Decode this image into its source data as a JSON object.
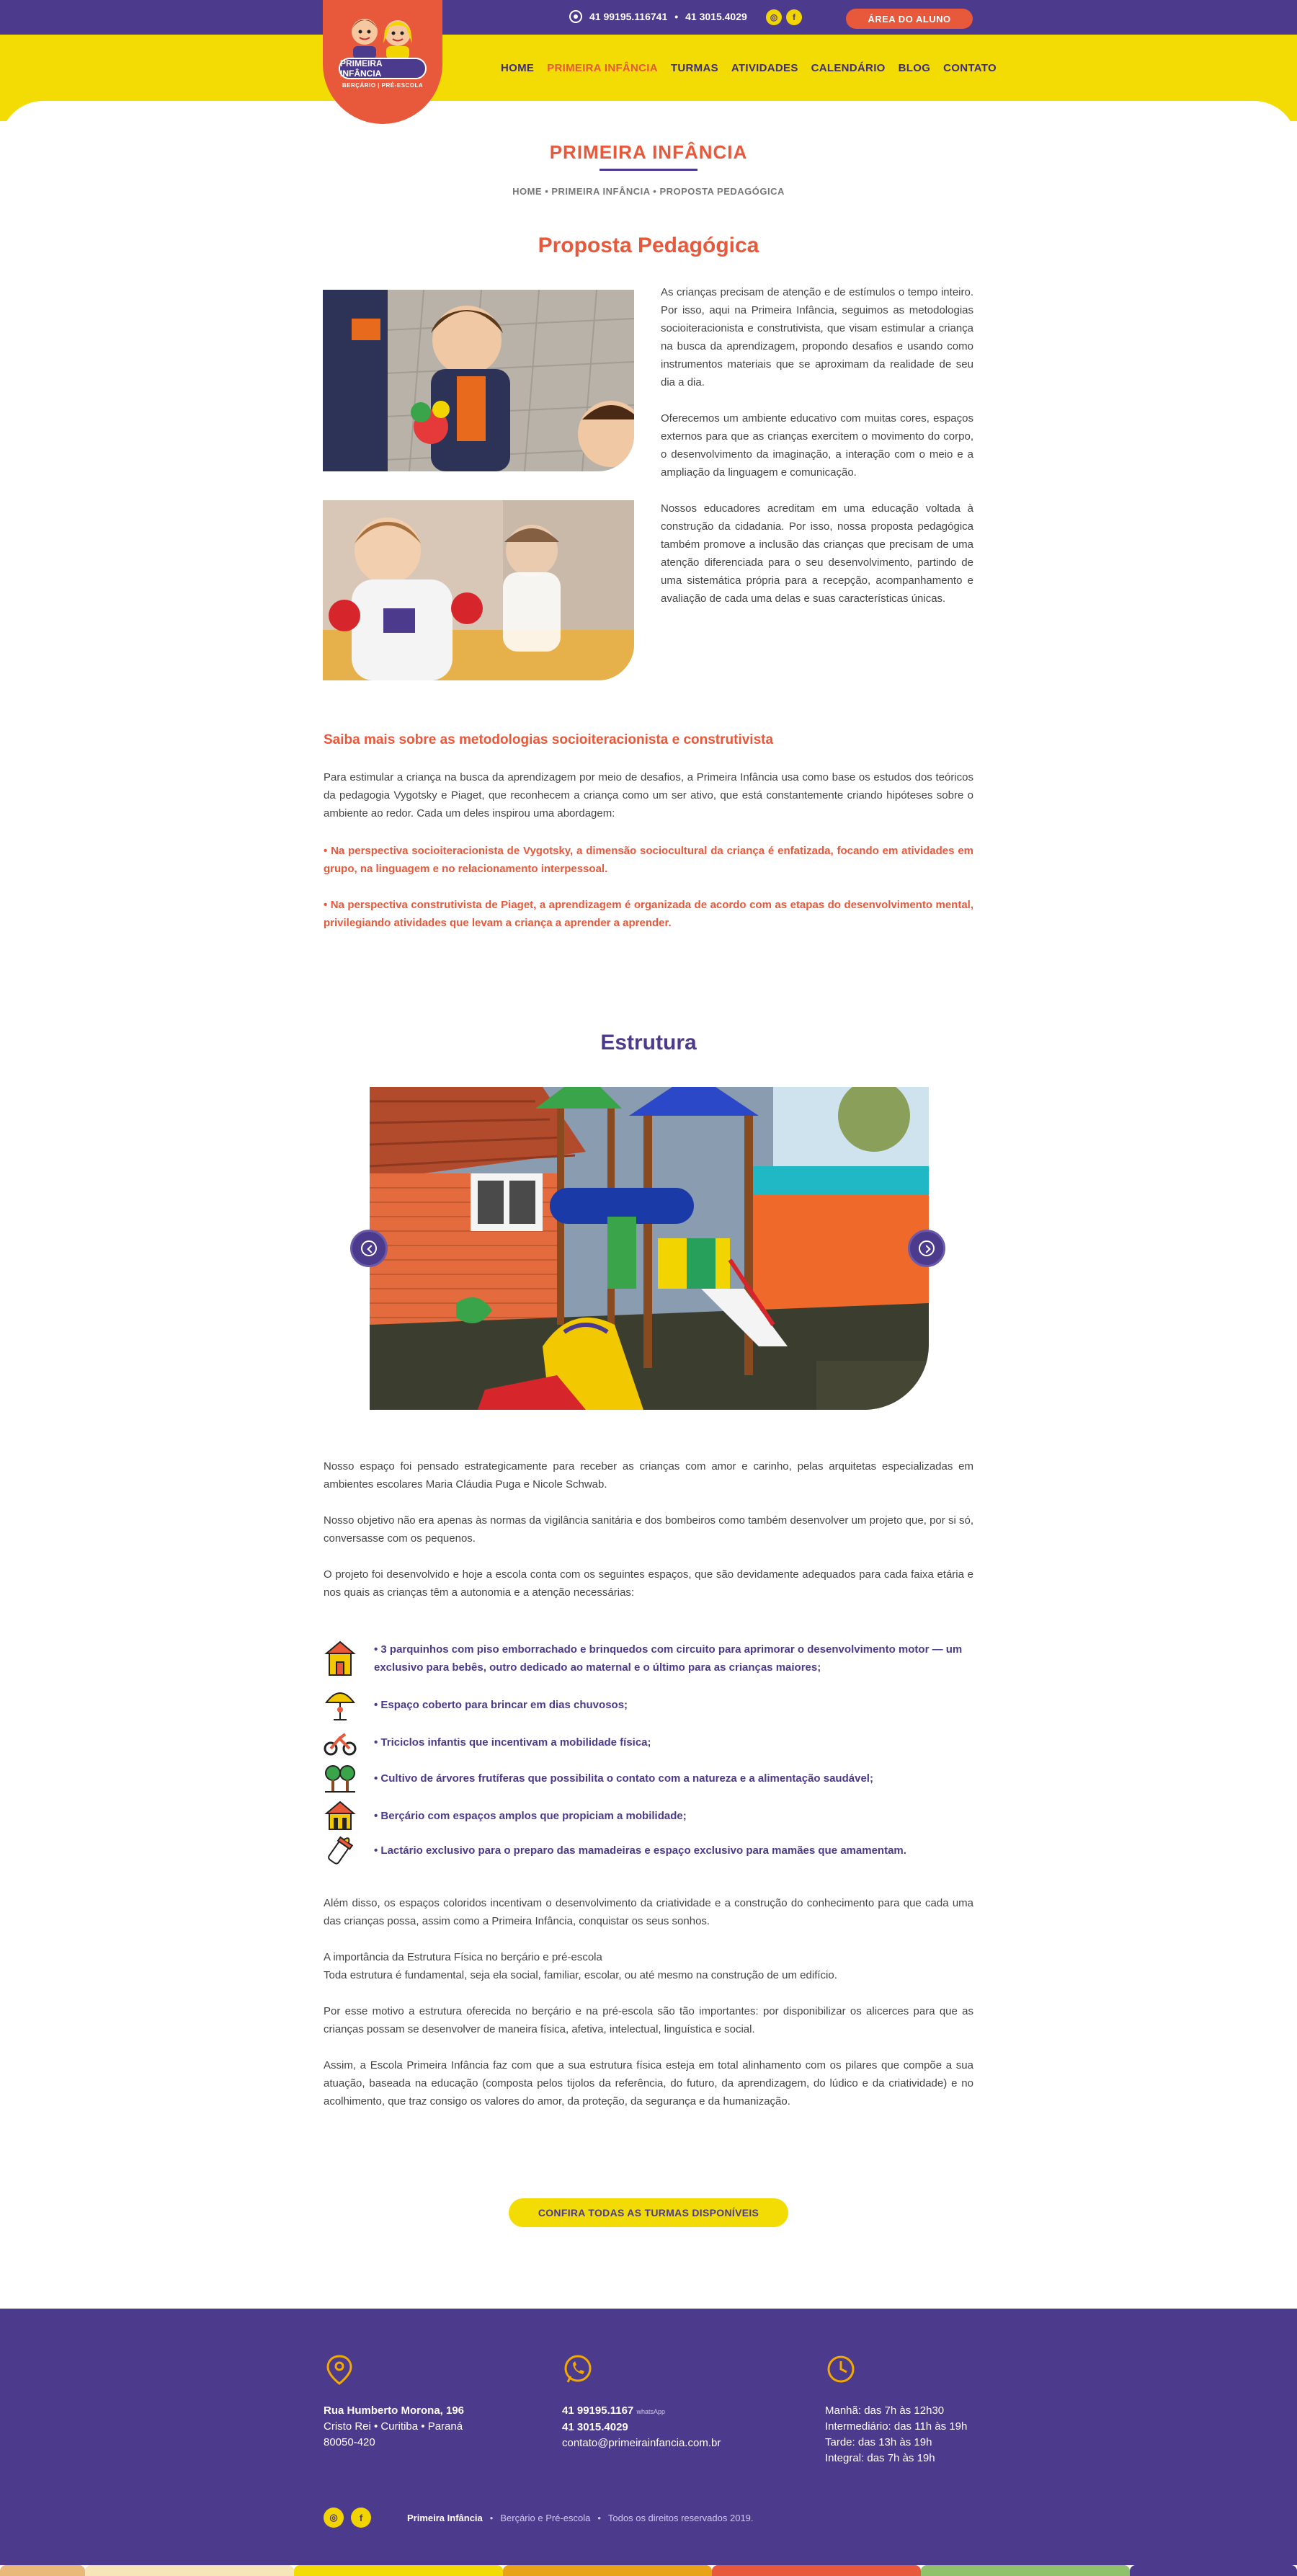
{
  "topbar": {
    "phone_whatsapp": "41 99195.1167 41",
    "phone_1": "41 99195.1167 41",
    "separator": "•",
    "phone_2": "41 3015.4029",
    "social": [
      "◎",
      "f"
    ],
    "area_button": "ÁREA DO ALUNO"
  },
  "logo": {
    "name": "PRIMEIRA INFÂNCIA",
    "subtitle": "BERÇÁRIO  |  PRÉ-ESCOLA"
  },
  "nav": {
    "items": [
      {
        "label": "HOME",
        "active": false
      },
      {
        "label": "PRIMEIRA INFÂNCIA",
        "active": true
      },
      {
        "label": "TURMAS",
        "active": false
      },
      {
        "label": "ATIVIDADES",
        "active": false
      },
      {
        "label": "CALENDÁRIO",
        "active": false
      },
      {
        "label": "BLOG",
        "active": false
      },
      {
        "label": "CONTATO",
        "active": false
      }
    ]
  },
  "page": {
    "title": "PRIMEIRA INFÂNCIA",
    "breadcrumb": "HOME • PRIMEIRA INFÂNCIA • PROPOSTA PEDAGÓGICA"
  },
  "proposta": {
    "title": "Proposta Pedagógica",
    "paragraphs": [
      "As crianças precisam de atenção e de estímulos o tempo inteiro. Por isso, aqui na Primeira Infância, seguimos as metodologias socioiteracionista e construtivista, que visam estimular a criança na busca da aprendizagem, propondo desafios e usando como instrumentos materiais que se aproximam da realidade de seu dia a dia.",
      "Oferecemos um ambiente educativo com muitas cores, espaços externos para que as crianças exercitem o movimento do corpo, o desenvolvimento da imaginação, a interação com o meio e a ampliação da linguagem e comunicação.",
      "Nossos educadores acreditam em uma educação voltada à construção da cidadania. Por isso, nossa proposta pedagógica também promove a inclusão das crianças que precisam de uma atenção diferenciada para o seu desenvolvimento, partindo de uma sistemática própria para a recepção, acompanhamento e avaliação de cada uma delas e suas características únicas."
    ]
  },
  "metodologias": {
    "title": "Saiba mais sobre as metodologias socioiteracionista e construtivista",
    "intro": "Para estimular a criança na busca da aprendizagem por meio de desafios, a Primeira Infância usa como base os estudos dos teóricos da pedagogia Vygotsky e Piaget, que reconhecem a criança como um ser ativo, que está constantemente criando hipóteses sobre o ambiente ao redor. Cada um deles inspirou uma abordagem:",
    "bullets": [
      "•   Na perspectiva socioiteracionista de Vygotsky, a dimensão sociocultural da criança é enfatizada, focando em atividades em grupo, na linguagem e no relacionamento interpessoal.",
      "•   Na perspectiva construtivista de Piaget, a aprendizagem é organizada de acordo com as etapas do desenvolvimento mental, privilegiando atividades que levam a criança a aprender a aprender."
    ]
  },
  "estrutura": {
    "title": "Estrutura",
    "paragraphs": [
      "Nosso espaço foi pensado estrategicamente para receber as crianças com amor e carinho, pelas arquitetas especializadas em ambientes escolares Maria Cláudia Puga e Nicole Schwab.",
      "Nosso objetivo não era apenas às normas da vigilância sanitária e dos bombeiros como também desenvolver um projeto que, por si só, conversasse com os pequenos.",
      "O projeto foi desenvolvido e hoje a escola conta com os seguintes espaços, que são devidamente adequados para cada faixa etária e nos quais as crianças têm a autonomia e a atenção necessárias:"
    ],
    "features": [
      {
        "icon": "playground-icon",
        "text": "•  3 parquinhos com piso emborrachado e brinquedos com  circuito para aprimorar o desenvolvimento motor — um exclusivo para bebês, outro dedicado ao maternal e o último para as crianças maiores;"
      },
      {
        "icon": "umbrella-icon",
        "text": "•  Espaço coberto para brincar em dias chuvosos;"
      },
      {
        "icon": "tricycle-icon",
        "text": "•  Triciclos infantis que incentivam a mobilidade física;"
      },
      {
        "icon": "trees-icon",
        "text": "•  Cultivo de árvores frutíferas que possibilita o contato com a natureza e a alimentação saudável;"
      },
      {
        "icon": "house-icon",
        "text": "•  Berçário com espaços amplos que propiciam a mobilidade;"
      },
      {
        "icon": "baby-bottle-icon",
        "text": "•  Lactário exclusivo para o preparo das mamadeiras e espaço exclusivo para mamães que amamentam."
      }
    ],
    "closing": [
      "Além disso, os espaços coloridos incentivam o desenvolvimento da criatividade e a construção do conhecimento para que cada uma das crianças possa, assim como a Primeira Infância, conquistar os seus sonhos.",
      "A importância da Estrutura Física no berçário e pré-escola\nToda estrutura é fundamental, seja ela social, familiar, escolar, ou até mesmo na construção de um edifício.",
      "Por esse motivo a estrutura oferecida no berçário e na pré-escola são tão importantes: por disponibilizar os alicerces para que as crianças possam se desenvolver de maneira física, afetiva, intelectual, linguística e social.",
      "Assim, a Escola Primeira Infância faz com que a sua estrutura física esteja em total alinhamento com os pilares que compõe a sua atuação, baseada na educação (composta pelos tijolos da referência, do futuro, da aprendizagem, do lúdico e da criatividade) e no acolhimento, que traz consigo os valores do amor, da proteção, da segurança e da humanização."
    ],
    "cta": "CONFIRA TODAS AS TURMAS DISPONÍVEIS"
  },
  "footer": {
    "address": {
      "street": "Rua Humberto Morona, 196",
      "city": "Cristo Rei  •  Curitiba  •  Paraná",
      "zip": "80050-420"
    },
    "contact": {
      "phone_1": "41 99195.1167",
      "phone_1_note": "whatsApp",
      "phone_2": "41 3015.4029",
      "email": "contato@primeirainfancia.com.br"
    },
    "hours": [
      "Manhã: das 7h às 12h30",
      "Intermediário: das 11h às 19h",
      "Tarde: das 13h às 19h",
      "Integral: das 7h às 19h"
    ],
    "brand": "Primeira Infância",
    "tagline": "Berçário e Pré-escola",
    "rights": "Todos os direitos reservados 2019.",
    "dot": "•"
  },
  "colors": {
    "purple": "#4c3a8c",
    "orange": "#e8583b",
    "yellow": "#f2dc04",
    "strip": [
      "#e9b97a",
      "#f6e6b8",
      "#f2dc04",
      "#e8a317",
      "#e8583b",
      "#8fc26a"
    ]
  }
}
